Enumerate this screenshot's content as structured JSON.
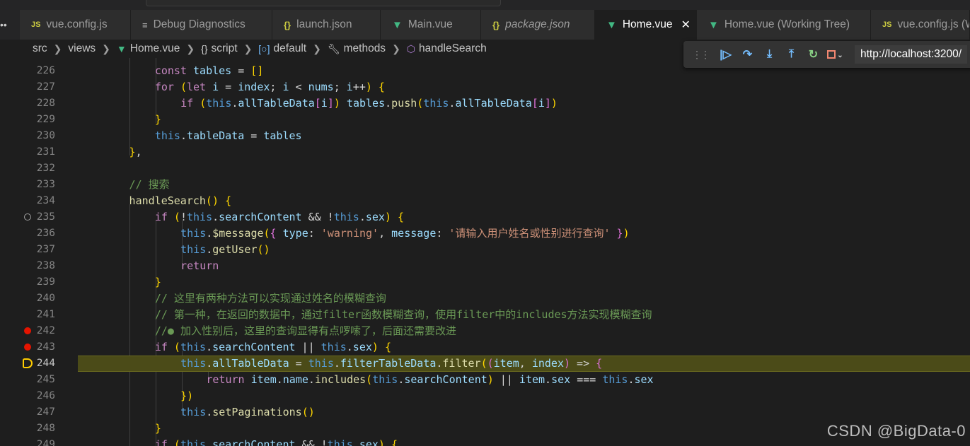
{
  "tabs": [
    {
      "label": "vue.config.js",
      "icon": "js-file-icon",
      "active": false
    },
    {
      "label": "Debug Diagnostics",
      "icon": "debug-diagnostics-icon",
      "active": false
    },
    {
      "label": "launch.json",
      "icon": "json-file-icon",
      "active": false
    },
    {
      "label": "Main.vue",
      "icon": "vue-file-icon",
      "active": false
    },
    {
      "label": "package.json",
      "icon": "json-file-icon",
      "active": false
    },
    {
      "label": "Home.vue",
      "icon": "vue-file-icon",
      "active": true
    },
    {
      "label": "Home.vue (Working Tree)",
      "icon": "vue-file-icon",
      "active": false
    },
    {
      "label": "vue.config.js (W",
      "icon": "js-file-icon",
      "active": false
    }
  ],
  "breadcrumbs": [
    "src",
    "views",
    "Home.vue",
    "script",
    "default",
    "methods",
    "handleSearch"
  ],
  "debug_toolbar": {
    "url": "http://localhost:3200/",
    "buttons": [
      "continue",
      "step-over",
      "step-into",
      "step-out",
      "restart",
      "stop"
    ]
  },
  "editor": {
    "lines": [
      {
        "n": "226",
        "text": "const tables = []"
      },
      {
        "n": "227",
        "text": "for (let i = index; i < nums; i++) {"
      },
      {
        "n": "228",
        "text": "if (this.allTableData[i]) tables.push(this.allTableData[i])"
      },
      {
        "n": "229",
        "text": "}"
      },
      {
        "n": "230",
        "text": "this.tableData = tables"
      },
      {
        "n": "231",
        "text": "},"
      },
      {
        "n": "232",
        "text": ""
      },
      {
        "n": "233",
        "text": "// 搜索"
      },
      {
        "n": "234",
        "text": "handleSearch() {"
      },
      {
        "n": "235",
        "text": "if (!this.searchContent && !this.sex) {"
      },
      {
        "n": "236",
        "text": "this.$message({ type: 'warning', message: '请输入用户姓名或性别进行查询' })"
      },
      {
        "n": "237",
        "text": "this.getUser()"
      },
      {
        "n": "238",
        "text": "return"
      },
      {
        "n": "239",
        "text": "}"
      },
      {
        "n": "240",
        "text": "// 这里有两种方法可以实现通过姓名的模糊查询"
      },
      {
        "n": "241",
        "text": "// 第一种，在返回的数据中，通过filter函数模糊查询，使用filter中的includes方法实现模糊查询"
      },
      {
        "n": "242",
        "text": "//● 加入性别后，这里的查询显得有点啰嗦了，后面还需要改进"
      },
      {
        "n": "243",
        "text": "if (this.searchContent || this.sex) {"
      },
      {
        "n": "244",
        "text": "this.allTableData = this.filterTableData.filter((item, index) => {"
      },
      {
        "n": "245",
        "text": "return item.name.includes(this.searchContent) || item.sex === this.sex"
      },
      {
        "n": "246",
        "text": "})"
      },
      {
        "n": "247",
        "text": "this.setPaginations()"
      },
      {
        "n": "248",
        "text": "}"
      },
      {
        "n": "249",
        "text": "if (this.searchContent && !this.sex) {"
      }
    ],
    "breakpoints": {
      "235": "hollow",
      "242": "active",
      "243": "active",
      "244": "current"
    },
    "current_line": "244"
  },
  "watermark": "CSDN @BigData-0"
}
